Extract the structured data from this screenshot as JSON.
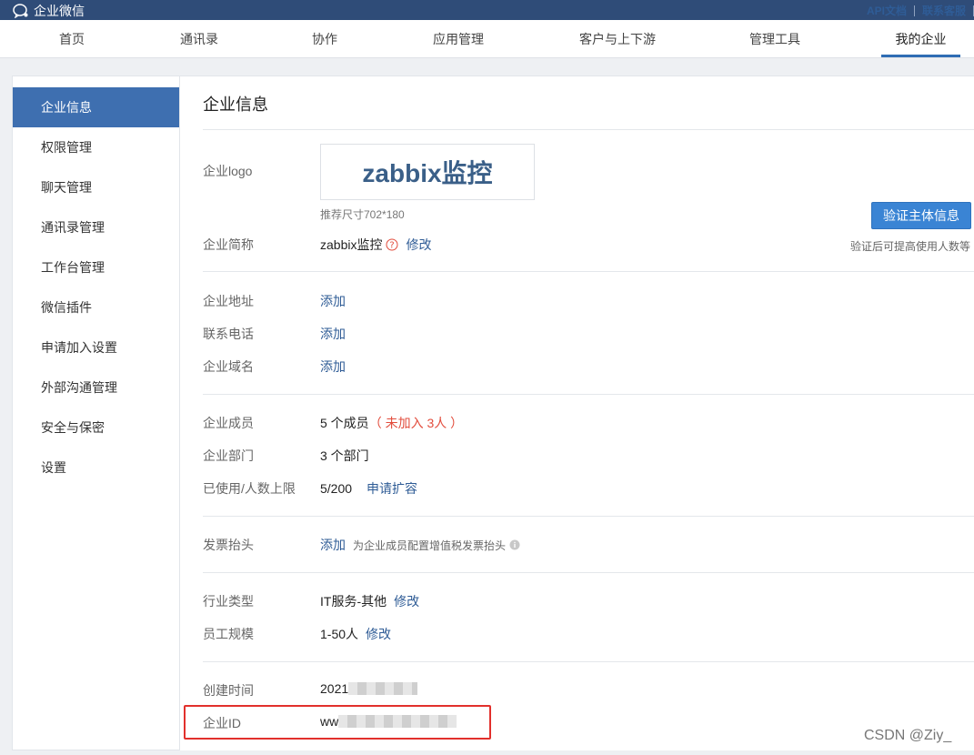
{
  "app": {
    "name": "企业微信"
  },
  "top_links": [
    "API文档",
    "联系客服"
  ],
  "nav": [
    "首页",
    "通讯录",
    "协作",
    "应用管理",
    "客户与上下游",
    "管理工具",
    "我的企业"
  ],
  "nav_active": "我的企业",
  "sidebar": [
    "企业信息",
    "权限管理",
    "聊天管理",
    "通讯录管理",
    "工作台管理",
    "微信插件",
    "申请加入设置",
    "外部沟通管理",
    "安全与保密",
    "设置"
  ],
  "sidebar_active": "企业信息",
  "page": {
    "title": "企业信息",
    "logo": {
      "label": "企业logo",
      "text": "zabbix监控",
      "size_hint": "推荐尺寸702*180"
    },
    "short_name": {
      "label": "企业简称",
      "value": "zabbix监控",
      "edit": "修改"
    },
    "verify": {
      "button": "验证主体信息",
      "hint": "验证后可提高使用人数等"
    },
    "address": {
      "label": "企业地址",
      "action": "添加"
    },
    "phone": {
      "label": "联系电话",
      "action": "添加"
    },
    "domain": {
      "label": "企业域名",
      "action": "添加"
    },
    "members": {
      "label": "企业成员",
      "value": "5 个成员",
      "pending": "（ 未加入 3人 ）"
    },
    "departments": {
      "label": "企业部门",
      "value": "3 个部门"
    },
    "usage": {
      "label": "已使用/人数上限",
      "value": "5/200",
      "action": "申请扩容"
    },
    "invoice": {
      "label": "发票抬头",
      "action": "添加",
      "hint": "为企业成员配置增值税发票抬头"
    },
    "industry": {
      "label": "行业类型",
      "value": "IT服务-其他",
      "edit": "修改"
    },
    "scale": {
      "label": "员工规模",
      "value": "1-50人",
      "edit": "修改"
    },
    "created": {
      "label": "创建时间",
      "value": "2021"
    },
    "corp_id": {
      "label": "企业ID",
      "value": "ww"
    }
  },
  "watermark": "CSDN @Ziy_",
  "colors": {
    "topbar": "#2f4c78",
    "accent": "#3e6fb0",
    "link": "#2f5c96",
    "warn": "#e24c3c",
    "highlight": "#e2302c"
  }
}
